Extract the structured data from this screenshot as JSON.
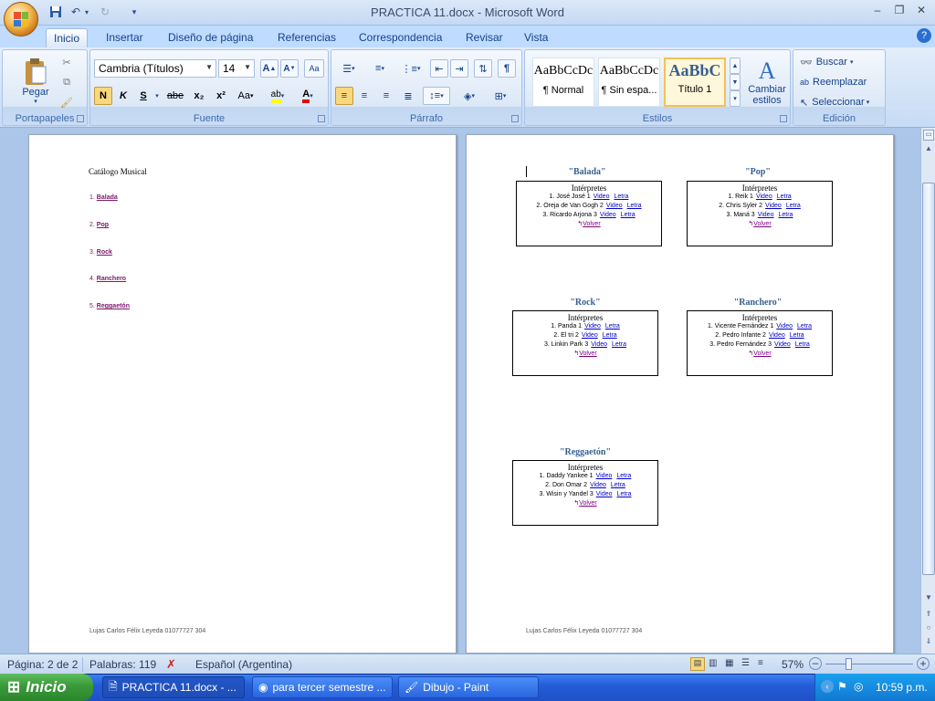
{
  "window": {
    "title": "PRACTICA 11.docx - Microsoft Word"
  },
  "tabs": [
    "Inicio",
    "Insertar",
    "Diseño de página",
    "Referencias",
    "Correspondencia",
    "Revisar",
    "Vista"
  ],
  "ribbon": {
    "clipboard": {
      "label": "Portapapeles",
      "paste": "Pegar"
    },
    "font": {
      "label": "Fuente",
      "family": "Cambria (Títulos)",
      "size": "14",
      "bold": "N",
      "italic": "K",
      "underline": "S",
      "strike": "abe",
      "sub": "x₂",
      "sup": "x²",
      "case": "Aa"
    },
    "paragraph": {
      "label": "Párrafo"
    },
    "styles": {
      "label": "Estilos",
      "items": [
        {
          "sample": "AaBbCcDc",
          "name": "¶ Normal"
        },
        {
          "sample": "AaBbCcDc",
          "name": "¶ Sin espa..."
        },
        {
          "sample": "AaBbC",
          "name": "Título 1"
        }
      ],
      "change": "Cambiar estilos"
    },
    "editing": {
      "label": "Edición",
      "find": "Buscar",
      "replace": "Reemplazar",
      "select": "Seleccionar"
    }
  },
  "document": {
    "page1": {
      "title": "Catálogo Musical",
      "toc": [
        {
          "num": "1.",
          "label": "Balada"
        },
        {
          "num": "2.",
          "label": "Pop"
        },
        {
          "num": "3.",
          "label": "Rock"
        },
        {
          "num": "4.",
          "label": "Ranchero"
        },
        {
          "num": "5.",
          "label": "Reggaetón"
        }
      ],
      "footer": "Lujas Carlos Félix Leyeda 01077727   304"
    },
    "page2": {
      "footer": "Lujas Carlos Félix Leyeda 01077727   304",
      "sections": [
        {
          "title": "\"Balada\"",
          "header": "Intérpretes",
          "rows": [
            {
              "text": "1. José José 1",
              "video": "Video",
              "lyrics": "Letra"
            },
            {
              "text": "2. Oreja de Van Gogh 2",
              "video": "Video",
              "lyrics": "Letra"
            },
            {
              "text": "3. Ricardo Arjona 3",
              "video": "Video",
              "lyrics": "Letra"
            }
          ],
          "back": "Volver"
        },
        {
          "title": "\"Pop\"",
          "header": "Intérpretes",
          "rows": [
            {
              "text": "1. Reik 1",
              "video": "Video",
              "lyrics": "Letra"
            },
            {
              "text": "2. Chris Syler 2",
              "video": "Video",
              "lyrics": "Letra"
            },
            {
              "text": "3. Maná 3",
              "video": "Video",
              "lyrics": "Letra"
            }
          ],
          "back": "Volver"
        },
        {
          "title": "\"Rock\"",
          "header": "Intérpretes",
          "rows": [
            {
              "text": "1. Panda 1",
              "video": "Video",
              "lyrics": "Letra"
            },
            {
              "text": "2. El tri 2",
              "video": "Video",
              "lyrics": "Letra"
            },
            {
              "text": "3. Linkin Park 3",
              "video": "Video",
              "lyrics": "Letra"
            }
          ],
          "back": "Volver"
        },
        {
          "title": "\"Ranchero\"",
          "header": "Intérpretes",
          "rows": [
            {
              "text": "1. Vicente Fernández 1",
              "video": "Video",
              "lyrics": "Letra"
            },
            {
              "text": "2. Pedro Infante 2",
              "video": "Video",
              "lyrics": "Letra"
            },
            {
              "text": "3. Pedro Fernández 3",
              "video": "Video",
              "lyrics": "Letra"
            }
          ],
          "back": "Volver"
        },
        {
          "title": "\"Reggaetón\"",
          "header": "Intérpretes",
          "rows": [
            {
              "text": "1. Daddy Yankee 1",
              "video": "Video",
              "lyrics": "Letra"
            },
            {
              "text": "2. Don Omar 2",
              "video": "Video",
              "lyrics": "Letra"
            },
            {
              "text": "3. Wisin y Yandel 3",
              "video": "Video",
              "lyrics": "Letra"
            }
          ],
          "back": "Volver"
        }
      ]
    }
  },
  "status": {
    "page": "Página: 2 de 2",
    "words": "Palabras: 119",
    "language": "Español (Argentina)",
    "zoom": "57%"
  },
  "taskbar": {
    "start": "Inicio",
    "tasks": [
      "PRACTICA 11.docx - ...",
      "para tercer semestre ...",
      "Dibujo - Paint"
    ],
    "clock": "10:59 p.m."
  }
}
